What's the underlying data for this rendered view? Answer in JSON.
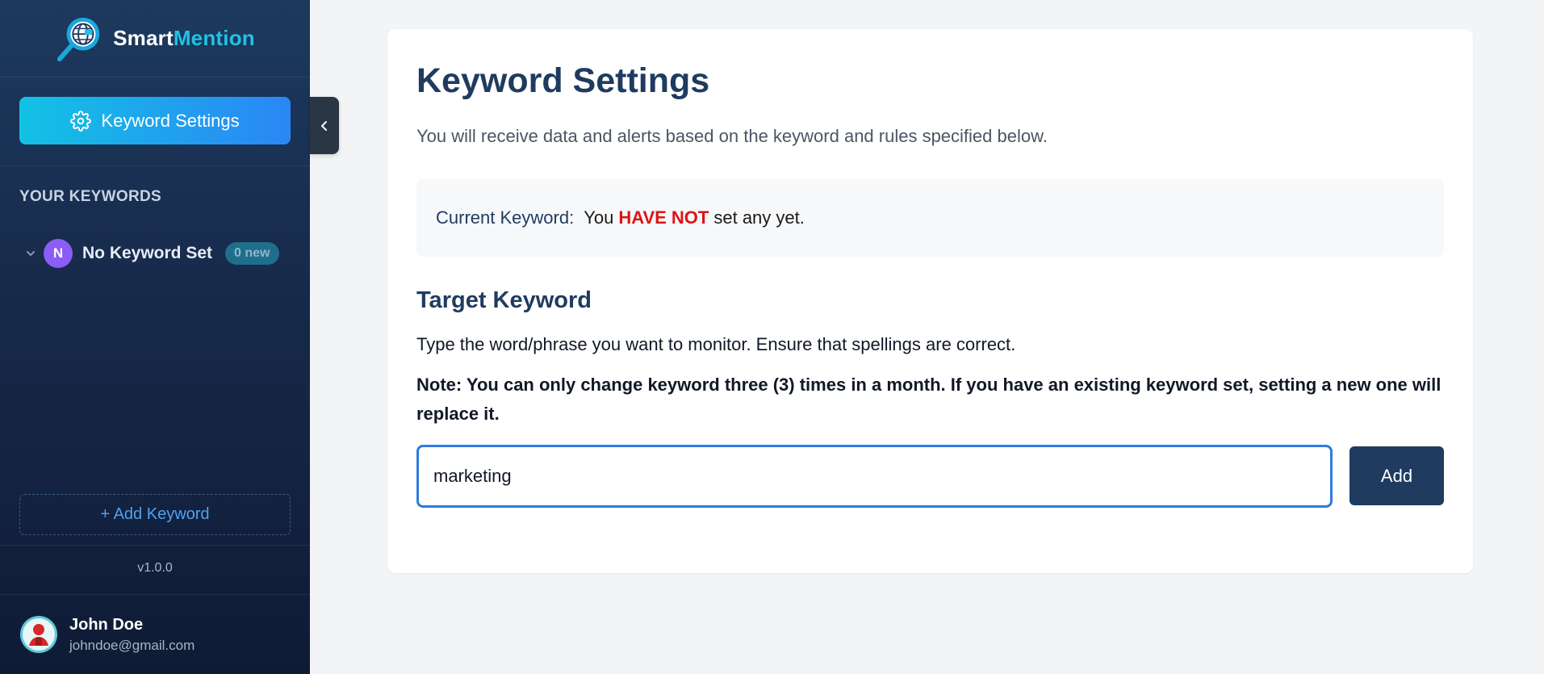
{
  "brand": {
    "name_main": "Smart",
    "name_accent": "Mention"
  },
  "sidebar": {
    "active_item": "Keyword Settings",
    "section_title": "YOUR KEYWORDS",
    "keywords": [
      {
        "avatar_letter": "N",
        "label": "No Keyword Set",
        "badge": "0 new"
      }
    ],
    "add_keyword": "+ Add Keyword",
    "version": "v1.0.0",
    "user": {
      "name": "John Doe",
      "email": "johndoe@gmail.com"
    }
  },
  "main": {
    "title": "Keyword Settings",
    "description": "You will receive data and alerts based on the keyword and rules specified below.",
    "current_keyword": {
      "label": "Current Keyword:",
      "text_before": "You",
      "highlight": "HAVE NOT",
      "text_after": "set any yet."
    },
    "target": {
      "heading": "Target Keyword",
      "helper": "Type the word/phrase you want to monitor. Ensure that spellings are correct.",
      "note": "Note: You can only change keyword three (3) times in a month. If you have an existing keyword set, setting a new one will replace it.",
      "input_value": "marketing",
      "add_button": "Add"
    }
  },
  "colors": {
    "accent": "#22c1e6",
    "primary": "#1f3b5f",
    "warning": "#dc1414",
    "input_border": "#2f7be0"
  },
  "icons": {
    "logo": "globe-magnifier-icon",
    "settings": "gear-icon",
    "collapse": "chevron-left-icon",
    "expand": "chevron-down-icon",
    "user": "avatar-icon"
  }
}
